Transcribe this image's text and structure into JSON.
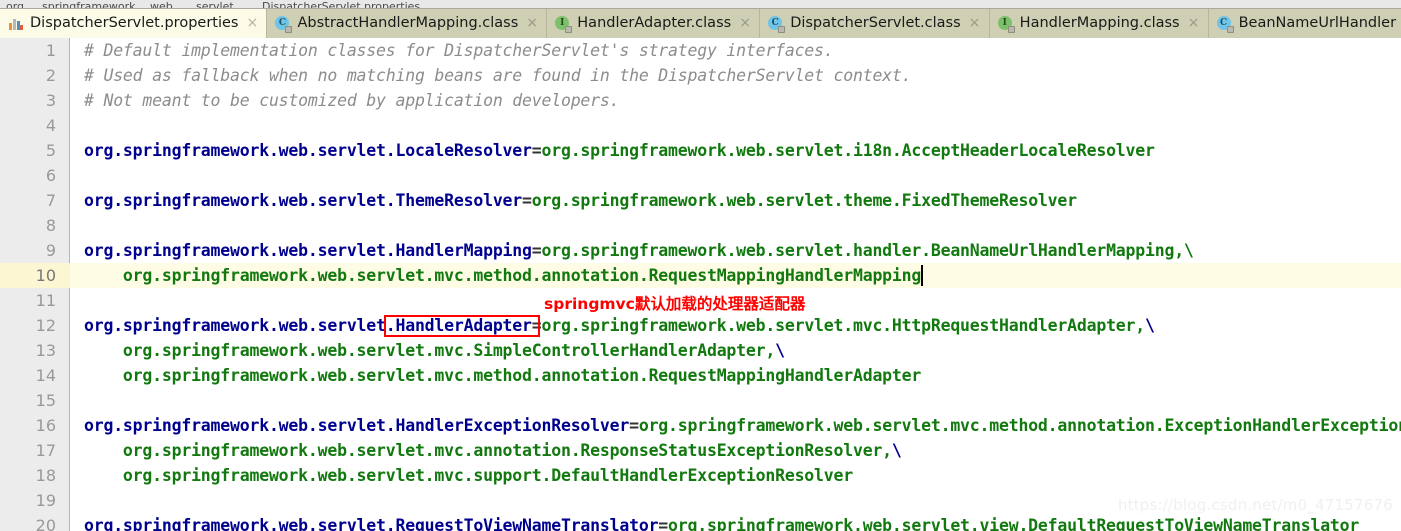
{
  "window": {
    "app": "IntelliJ IDEA Editor",
    "active_file": "DispatcherServlet.properties"
  },
  "breadcrumb": {
    "items": [
      "org",
      "springframework",
      "web",
      "servlet",
      "DispatcherServlet.properties"
    ]
  },
  "tabs": [
    {
      "label": "DispatcherServlet.properties",
      "icon": "properties-file-icon",
      "active": true,
      "close": "×"
    },
    {
      "label": "AbstractHandlerMapping.class",
      "icon": "java-class-icon",
      "active": false,
      "close": "×"
    },
    {
      "label": "HandlerAdapter.class",
      "icon": "java-interface-icon",
      "active": false,
      "close": "×"
    },
    {
      "label": "DispatcherServlet.class",
      "icon": "java-class-icon",
      "active": false,
      "close": "×"
    },
    {
      "label": "HandlerMapping.class",
      "icon": "java-interface-icon",
      "active": false,
      "close": "×"
    },
    {
      "label": "BeanNameUrlHandler",
      "icon": "java-class-icon",
      "active": false,
      "close": ""
    }
  ],
  "editor": {
    "current_line": 10,
    "caret_line": 10,
    "lines": [
      {
        "n": 1,
        "tokens": [
          {
            "t": "comment",
            "s": "# Default implementation classes for DispatcherServlet's strategy interfaces."
          }
        ]
      },
      {
        "n": 2,
        "tokens": [
          {
            "t": "comment",
            "s": "# Used as fallback when no matching beans are found in the DispatcherServlet context."
          }
        ]
      },
      {
        "n": 3,
        "tokens": [
          {
            "t": "comment",
            "s": "# Not meant to be customized by application developers."
          }
        ]
      },
      {
        "n": 4,
        "tokens": []
      },
      {
        "n": 5,
        "tokens": [
          {
            "t": "key",
            "s": "org.springframework.web.servlet.LocaleResolver"
          },
          {
            "t": "eq",
            "s": "="
          },
          {
            "t": "val",
            "s": "org.springframework.web.servlet.i18n.AcceptHeaderLocaleResolver"
          }
        ]
      },
      {
        "n": 6,
        "tokens": []
      },
      {
        "n": 7,
        "tokens": [
          {
            "t": "key",
            "s": "org.springframework.web.servlet.ThemeResolver"
          },
          {
            "t": "eq",
            "s": "="
          },
          {
            "t": "val",
            "s": "org.springframework.web.servlet.theme.FixedThemeResolver"
          }
        ]
      },
      {
        "n": 8,
        "tokens": []
      },
      {
        "n": 9,
        "tokens": [
          {
            "t": "key",
            "s": "org.springframework.web.servlet.HandlerMapping"
          },
          {
            "t": "eq",
            "s": "="
          },
          {
            "t": "val",
            "s": "org.springframework.web.servlet.handler.BeanNameUrlHandlerMapping,\\"
          }
        ]
      },
      {
        "n": 10,
        "tokens": [
          {
            "t": "val",
            "s": "    org.springframework.web.servlet.mvc.method.annotation.RequestMappingHandlerMapping"
          }
        ]
      },
      {
        "n": 11,
        "tokens": []
      },
      {
        "n": 12,
        "tokens": [
          {
            "t": "key",
            "s": "org.springframework.web.servlet.HandlerAdapter"
          },
          {
            "t": "eq",
            "s": "="
          },
          {
            "t": "val",
            "s": "org.springframework.web.servlet.mvc.HttpRequestHandlerAdapter,"
          },
          {
            "t": "slash",
            "s": "\\"
          }
        ]
      },
      {
        "n": 13,
        "tokens": [
          {
            "t": "val",
            "s": "    org.springframework.web.servlet.mvc.SimpleControllerHandlerAdapter,"
          },
          {
            "t": "slash",
            "s": "\\"
          }
        ]
      },
      {
        "n": 14,
        "tokens": [
          {
            "t": "val",
            "s": "    org.springframework.web.servlet.mvc.method.annotation.RequestMappingHandlerAdapter"
          }
        ]
      },
      {
        "n": 15,
        "tokens": []
      },
      {
        "n": 16,
        "tokens": [
          {
            "t": "key",
            "s": "org.springframework.web.servlet.HandlerExceptionResolver"
          },
          {
            "t": "eq",
            "s": "="
          },
          {
            "t": "val",
            "s": "org.springframework.web.servlet.mvc.method.annotation.ExceptionHandlerExceptionResolver,\\"
          }
        ]
      },
      {
        "n": 17,
        "tokens": [
          {
            "t": "val",
            "s": "    org.springframework.web.servlet.mvc.annotation.ResponseStatusExceptionResolver,"
          },
          {
            "t": "slash",
            "s": "\\"
          }
        ]
      },
      {
        "n": 18,
        "tokens": [
          {
            "t": "val",
            "s": "    org.springframework.web.servlet.mvc.support.DefaultHandlerExceptionResolver"
          }
        ]
      },
      {
        "n": 19,
        "tokens": []
      },
      {
        "n": 20,
        "tokens": [
          {
            "t": "key",
            "s": "org.springframework.web.servlet.RequestToViewNameTranslator"
          },
          {
            "t": "eq",
            "s": "="
          },
          {
            "t": "val",
            "s": "org.springframework.web.servlet.view.DefaultRequestToViewNameTranslator"
          }
        ]
      }
    ]
  },
  "annotation": {
    "text": "springmvc默认加载的处理器适配器",
    "color": "#ff0000",
    "box_target": ".HandlerAdapter"
  },
  "watermark": {
    "text": "https://blog.csdn.net/m0_47157676"
  },
  "colors": {
    "tab_active_bg": "#fbfbe7",
    "tab_inactive_bg": "#cfcfb4",
    "gutter_bg": "#ececec",
    "current_line_bg": "#fffce5",
    "key_color": "#00008f",
    "value_color": "#12790f",
    "comment_color": "#8c8c8c",
    "annotation_color": "#ff0000"
  }
}
